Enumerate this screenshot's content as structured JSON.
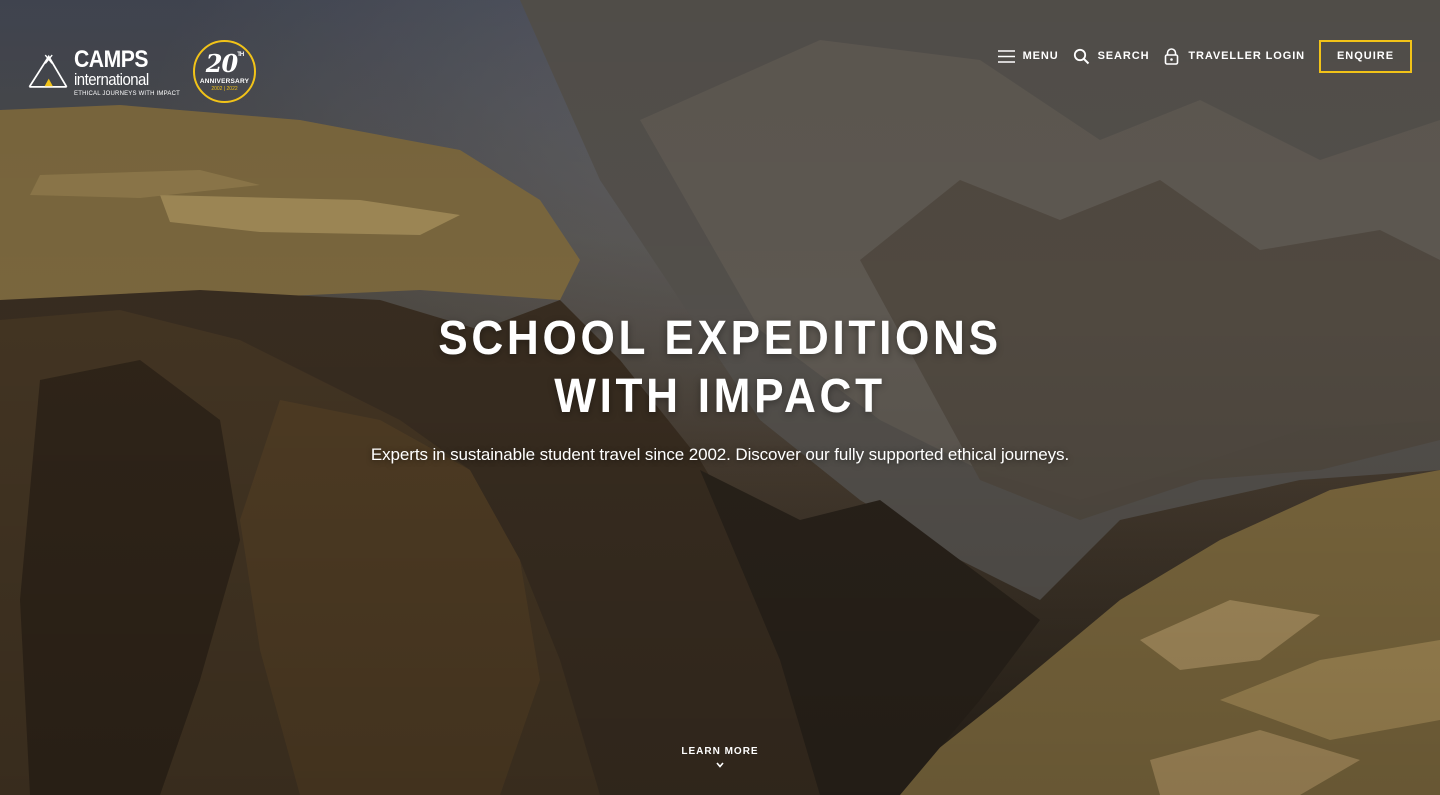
{
  "brand": {
    "name": "CAMPS",
    "subname": "international",
    "tagline": "ETHICAL JOURNEYS WITH IMPACT",
    "logo_icon": "tent-icon",
    "accent_color": "#f2c318"
  },
  "anniversary_badge": {
    "number": "20",
    "suffix": "TH",
    "label": "ANNIVERSARY",
    "years": "2002 | 2022"
  },
  "nav": {
    "menu": {
      "label": "MENU",
      "icon": "hamburger-icon"
    },
    "search": {
      "label": "SEARCH",
      "icon": "search-icon"
    },
    "login": {
      "label": "TRAVELLER LOGIN",
      "icon": "lock-icon"
    },
    "enquire": {
      "label": "ENQUIRE"
    }
  },
  "hero": {
    "title_line1": "SCHOOL EXPEDITIONS",
    "title_line2": "WITH IMPACT",
    "subtitle": "Experts in sustainable student travel since 2002. Discover our fully supported ethical journeys.",
    "learn_more": "LEARN MORE",
    "learn_more_icon": "chevron-down-icon"
  }
}
